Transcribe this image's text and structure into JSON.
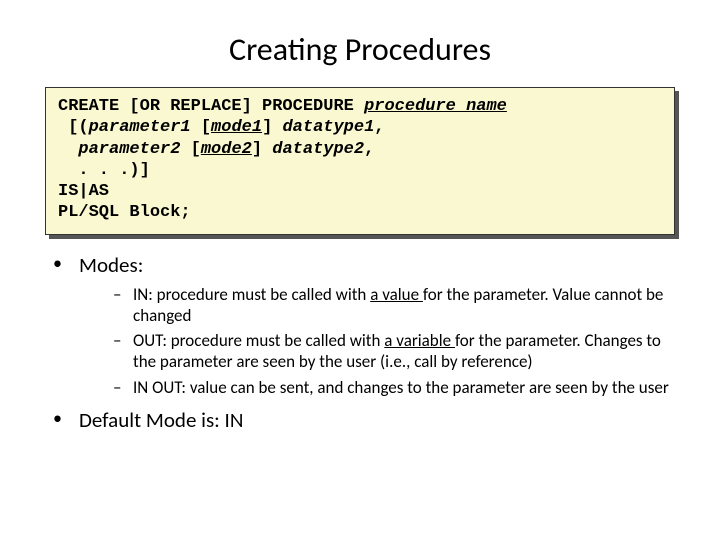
{
  "title": "Creating Procedures",
  "code": {
    "l1a": "CREATE [OR REPLACE] PROCEDURE ",
    "l1b": "procedure_name",
    "l2a": " [(",
    "l2b": "parameter1",
    "l2c": " [",
    "l2d": "mode1",
    "l2e": "] ",
    "l2f": "datatype1",
    "l2g": ",",
    "l3a": "  ",
    "l3b": "parameter2",
    "l3c": " [",
    "l3d": "mode2",
    "l3e": "] ",
    "l3f": "datatype2",
    "l3g": ",",
    "l4": "  . . .)]",
    "l5": "IS|AS",
    "l6": "PL/SQL Block;"
  },
  "modes_label": "Modes:",
  "mode_in_a": "IN: procedure must be called with ",
  "mode_in_u": "a value ",
  "mode_in_b": "for the parameter. Value cannot be changed",
  "mode_out_a": "OUT: procedure must be called with ",
  "mode_out_u": "a variable ",
  "mode_out_b": "for the parameter. Changes to the parameter are seen by the user (i.e., call by reference)",
  "mode_inout": "IN OUT: value can be sent, and changes to the parameter are seen by the user",
  "default_label": "Default Mode is: IN"
}
